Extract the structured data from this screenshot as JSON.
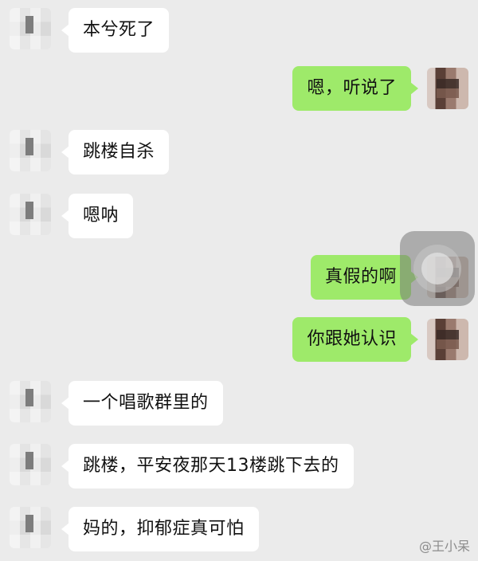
{
  "messages": [
    {
      "side": "left",
      "text": "本兮死了"
    },
    {
      "side": "right",
      "text": "嗯，听说了"
    },
    {
      "side": "left",
      "text": "跳楼自杀"
    },
    {
      "side": "left",
      "text": "嗯呐"
    },
    {
      "side": "right",
      "text": "真假的啊"
    },
    {
      "side": "right",
      "text": "你跟她认识"
    },
    {
      "side": "left",
      "text": "一个唱歌群里的"
    },
    {
      "side": "left",
      "text": "跳楼，平安夜那天13楼跳下去的"
    },
    {
      "side": "left",
      "text": "妈的，抑郁症真可怕"
    }
  ],
  "watermark": "@王小呆"
}
